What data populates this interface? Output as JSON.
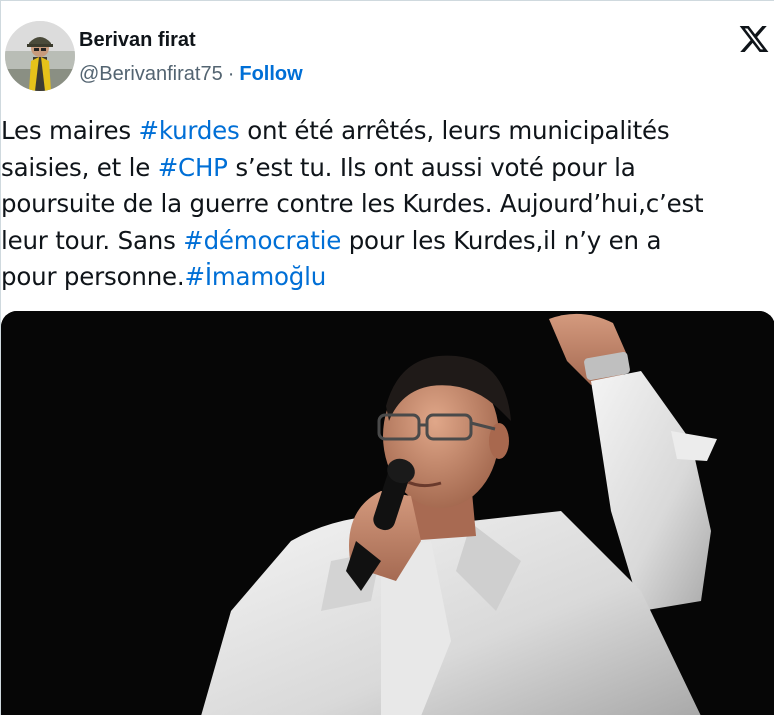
{
  "author": {
    "name": "Berivan firat",
    "handle": "@Berivanfirat75",
    "separator": "·",
    "follow_label": "Follow",
    "avatar_icon": "profile-photo"
  },
  "brand": {
    "logo_icon": "x-logo-icon"
  },
  "tweet": {
    "segments": [
      {
        "text": "Les maires ",
        "hashtag": false
      },
      {
        "text": "#kurdes",
        "hashtag": true
      },
      {
        "text": " ont été arrêtés, leurs municipalités\nsaisies, et le ",
        "hashtag": false
      },
      {
        "text": "#CHP",
        "hashtag": true
      },
      {
        "text": " s’est tu. Ils ont aussi voté pour la\npoursuite de la guerre contre les Kurdes. Aujourd’hui,c’est\nleur tour. Sans ",
        "hashtag": false
      },
      {
        "text": "#démocratie",
        "hashtag": true
      },
      {
        "text": " pour les Kurdes,il n’y en a\npour personne.",
        "hashtag": false
      },
      {
        "text": "#İmamoğlu",
        "hashtag": true
      }
    ]
  },
  "media": {
    "type": "photo",
    "subject": "man in white shirt speaking into microphone with raised fist"
  },
  "colors": {
    "link": "#006fd6",
    "text": "#0f1419",
    "secondary": "#536471",
    "photo_background": "#050505"
  }
}
